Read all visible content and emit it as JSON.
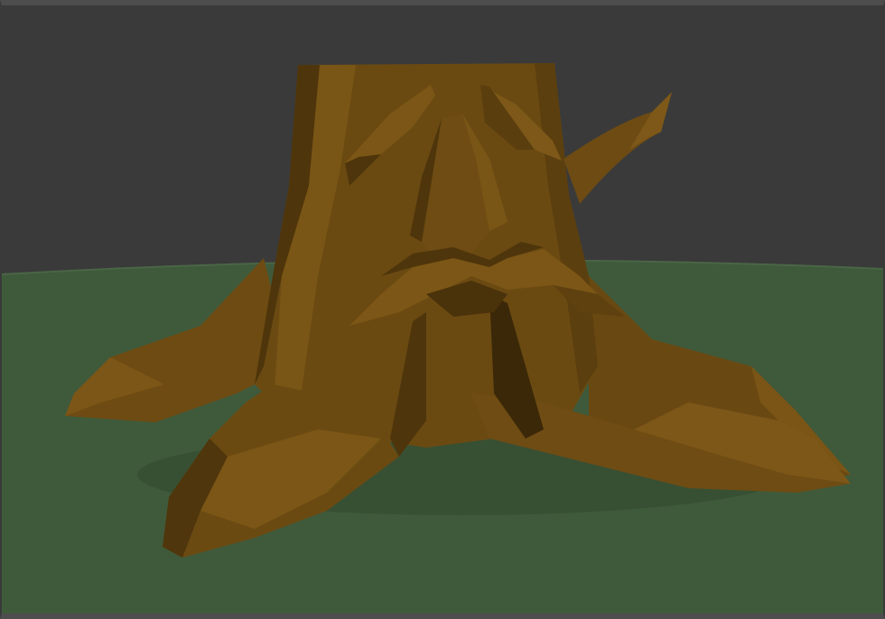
{
  "viewport": {
    "background_color": "#3a3a3a",
    "ground_color": "#3f5a3b",
    "object": "tree-stump-with-face",
    "object_colors": {
      "base": "#6b4a12",
      "light": "#7f5a18",
      "shadow": "#4e350b",
      "dark": "#3b2808"
    }
  }
}
